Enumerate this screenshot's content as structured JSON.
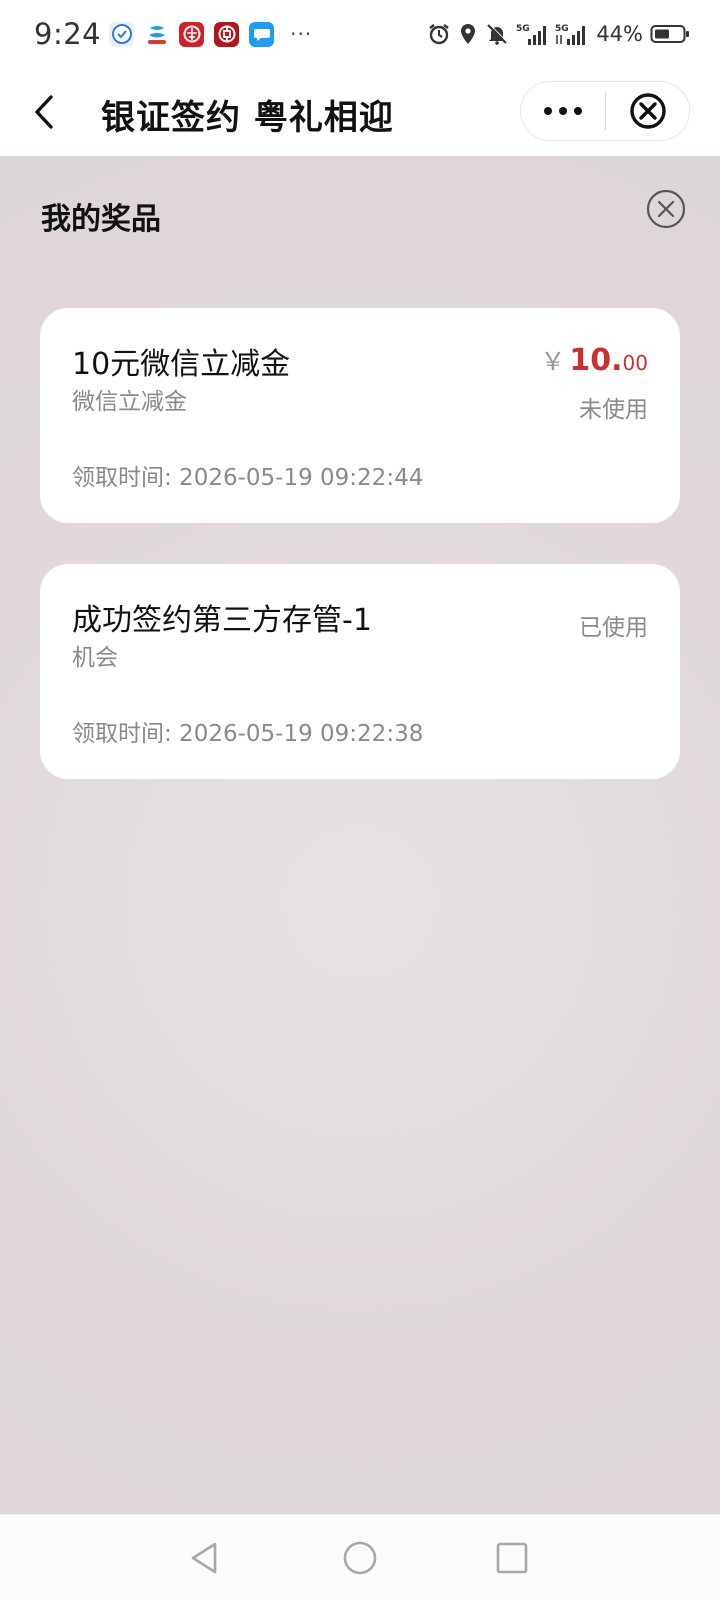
{
  "status_bar": {
    "time": "9:24",
    "battery_pct": "44%",
    "net1": "5G",
    "net2": "5G",
    "app_icons": [
      "security-app-icon",
      "stock-app-icon",
      "china-railway-icon",
      "bank-app-icon",
      "message-app-icon"
    ],
    "right_icons": [
      "alarm-icon",
      "location-icon",
      "mute-icon",
      "signal-icon",
      "signal-icon",
      "battery-icon"
    ]
  },
  "nav": {
    "title": "银证签约 粤礼相迎"
  },
  "panel": {
    "title": "我的奖品",
    "prizes": [
      {
        "name": "10元微信立减金",
        "sub": "微信立减金",
        "price_symbol": "￥",
        "price_int": "10.",
        "price_dec": "00",
        "status": "未使用",
        "time": "领取时间: 2026-05-19 09:22:44"
      },
      {
        "name": "成功签约第三方存管-1",
        "sub": "机会",
        "status": "已使用",
        "time": "领取时间: 2026-05-19 09:22:38"
      }
    ]
  },
  "colors": {
    "accent_red": "#c8322f",
    "overlay_bg": "#dfd7d8",
    "muted_text": "#8a8a8a"
  }
}
